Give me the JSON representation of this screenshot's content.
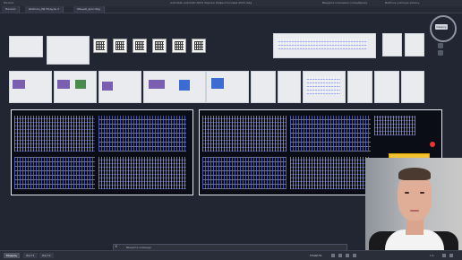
{
  "window": {
    "title": "Autodesk AutoCAD 2024  Чертеж Кафе-Столовая 2024.dwg",
    "left_tab": "Начало",
    "search": "Введите ключевое слово/фразу",
    "user": "Войти в учетную запись"
  },
  "tabs": [
    {
      "label": "Начало"
    },
    {
      "label": "Шаблон_РД Модуль 2"
    },
    {
      "label": "Общий_дом.dwg"
    }
  ],
  "viewcube": {
    "label": "Сверху"
  },
  "command": {
    "placeholder": "Введите команду"
  },
  "layout_tabs": [
    {
      "label": "Модель",
      "active": true
    },
    {
      "label": "Лист1",
      "active": false
    },
    {
      "label": "Лист2",
      "active": false
    }
  ],
  "status": {
    "mode": "МОДЕЛЬ",
    "scale": "1:1"
  },
  "colors": {
    "background": "#1f2430",
    "sheet_border": "#cfd3dc",
    "highlight": "#f2c232",
    "alert": "#e33333"
  }
}
